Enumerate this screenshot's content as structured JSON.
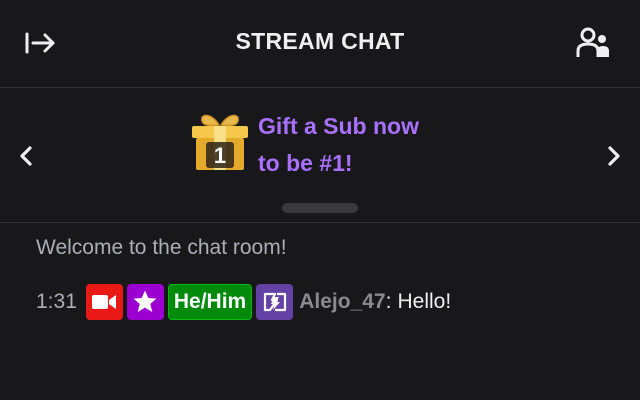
{
  "header": {
    "title": "STREAM CHAT",
    "collapse_icon": "collapse-arrow-icon",
    "users_icon": "community-users-icon"
  },
  "promo": {
    "line1": "Gift a Sub now",
    "line2": "to be #1!",
    "gift_rank": "1",
    "prev_icon": "chevron-left-icon",
    "next_icon": "chevron-right-icon",
    "accent_color": "#a970ff"
  },
  "chat": {
    "welcome": "Welcome to the chat room!",
    "messages": [
      {
        "time": "1:31",
        "badges": [
          "video-camera-icon",
          "star-icon",
          "pronoun-badge",
          "prime-lightning-icon"
        ],
        "pronoun": "He/Him",
        "username": "Alejo_47",
        "separator": ":",
        "text": "Hello!"
      }
    ]
  },
  "colors": {
    "background": "#18181b",
    "divider": "#323236",
    "video_badge": "#e91916",
    "star_badge": "#9b00d1",
    "pronoun_badge": "#008a0c",
    "prime_badge": "#6441a4"
  }
}
